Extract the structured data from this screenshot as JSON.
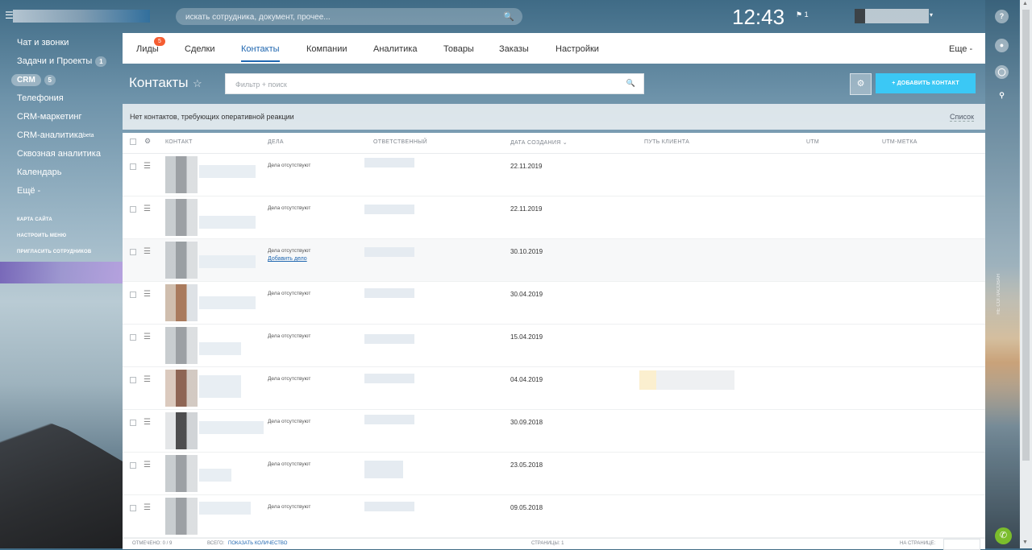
{
  "topbar": {
    "search_placeholder": "искать сотрудника, документ, прочее...",
    "clock": "12:43",
    "flag": "⚑ 1"
  },
  "left_menu": {
    "items": [
      {
        "label": "Чат и звонки"
      },
      {
        "label": "Задачи и Проекты",
        "counter": "1"
      },
      {
        "label": "CRM",
        "counter": "5"
      },
      {
        "label": "Телефония"
      },
      {
        "label": "CRM-маркетинг"
      },
      {
        "label": "CRM-аналитика",
        "sup": "beta"
      },
      {
        "label": "Сквозная аналитика"
      },
      {
        "label": "Календарь"
      },
      {
        "label": "Ещё -"
      }
    ],
    "small_items": [
      "КАРТА САЙТА",
      "НАСТРОИТЬ МЕНЮ",
      "ПРИГЛАСИТЬ СОТРУДНИКОВ"
    ]
  },
  "tabs": {
    "items": [
      {
        "label": "Лиды",
        "badge": "5"
      },
      {
        "label": "Сделки"
      },
      {
        "label": "Контакты"
      },
      {
        "label": "Компании"
      },
      {
        "label": "Аналитика"
      },
      {
        "label": "Товары"
      },
      {
        "label": "Заказы"
      },
      {
        "label": "Настройки"
      }
    ],
    "more": "Еще -"
  },
  "toolbar": {
    "title": "Контакты",
    "filter_placeholder": "Фильтр + поиск",
    "add_button": "+   ДОБАВИТЬ КОНТАКТ"
  },
  "notice": {
    "text": "Нет контактов, требующих оперативной реакции",
    "view": "Список"
  },
  "grid": {
    "columns": [
      "КОНТАКТ",
      "ДЕЛА",
      "ОТВЕТСТВЕННЫЙ",
      "ДАТА СОЗДАНИЯ ⌄",
      "ПУТЬ КЛИЕНТА",
      "UTM",
      "UTM-МЕТКА"
    ],
    "rows": [
      {
        "deals": "Дела отсутствуют",
        "date": "22.11.2019"
      },
      {
        "deals": "Дела отсутствуют",
        "date": "22.11.2019"
      },
      {
        "deals": "Дела отсутствуют",
        "add_deal": "Добавить дело",
        "date": "30.10.2019"
      },
      {
        "deals": "Дела отсутствуют",
        "date": "30.04.2019"
      },
      {
        "deals": "Дела отсутствуют",
        "date": "15.04.2019"
      },
      {
        "deals": "Дела отсутствуют",
        "date": "04.04.2019"
      },
      {
        "deals": "Дела отсутствуют",
        "date": "30.09.2018"
      },
      {
        "deals": "Дела отсутствуют",
        "date": "23.05.2018"
      },
      {
        "deals": "Дела отсутствуют",
        "date": "09.05.2018"
      }
    ]
  },
  "footer": {
    "selected": "ОТМЕЧЕНО: 0 / 9",
    "total_label": "ВСЕГО:",
    "show_count": "ПОКАЗАТЬ КОЛИЧЕСТВО",
    "pages": "СТРАНИЦЫ: 1",
    "per_page": "НА СТРАНИЦЕ:"
  },
  "right_bar": {
    "vertical": "НЕ СОГЛАСОВАН"
  }
}
